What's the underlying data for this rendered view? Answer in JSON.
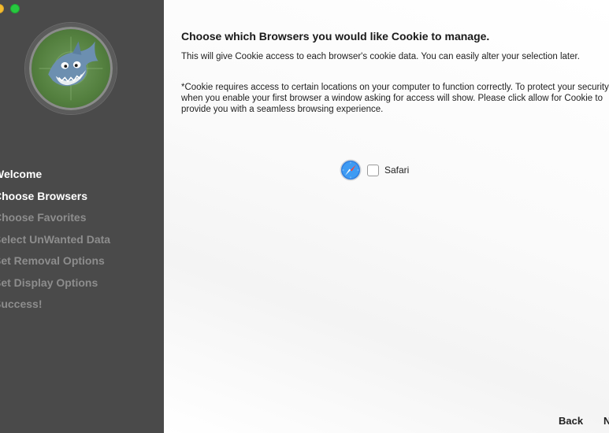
{
  "window": {
    "traffic_lights": [
      {
        "name": "minimize",
        "color": "#f5bd2f"
      },
      {
        "name": "zoom",
        "color": "#27c93f"
      }
    ]
  },
  "sidebar": {
    "logo_icon": "shark-radar-logo",
    "steps": [
      {
        "label": "Welcome",
        "state": "done"
      },
      {
        "label": "Choose Browsers",
        "state": "current"
      },
      {
        "label": "Choose Favorites",
        "state": "todo"
      },
      {
        "label": "Select UnWanted Data",
        "state": "todo"
      },
      {
        "label": "Set Removal Options",
        "state": "todo"
      },
      {
        "label": "Set Display Options",
        "state": "todo"
      },
      {
        "label": "Success!",
        "state": "todo"
      }
    ]
  },
  "main": {
    "heading": "Choose which Browsers you would like Cookie to manage.",
    "description": "This will give Cookie access to each browser's cookie data. You can easily alter your selection later.",
    "notice": "*Cookie requires access to certain locations on your computer to function correctly. To protect your security, when you enable your first browser a window asking for access will show. Please click allow for Cookie to provide you with a seamless browsing experience.",
    "browsers": [
      {
        "name": "Safari",
        "icon": "safari-compass-icon",
        "checked": false
      }
    ]
  },
  "footer": {
    "back_label": "Back",
    "next_label": "N"
  }
}
